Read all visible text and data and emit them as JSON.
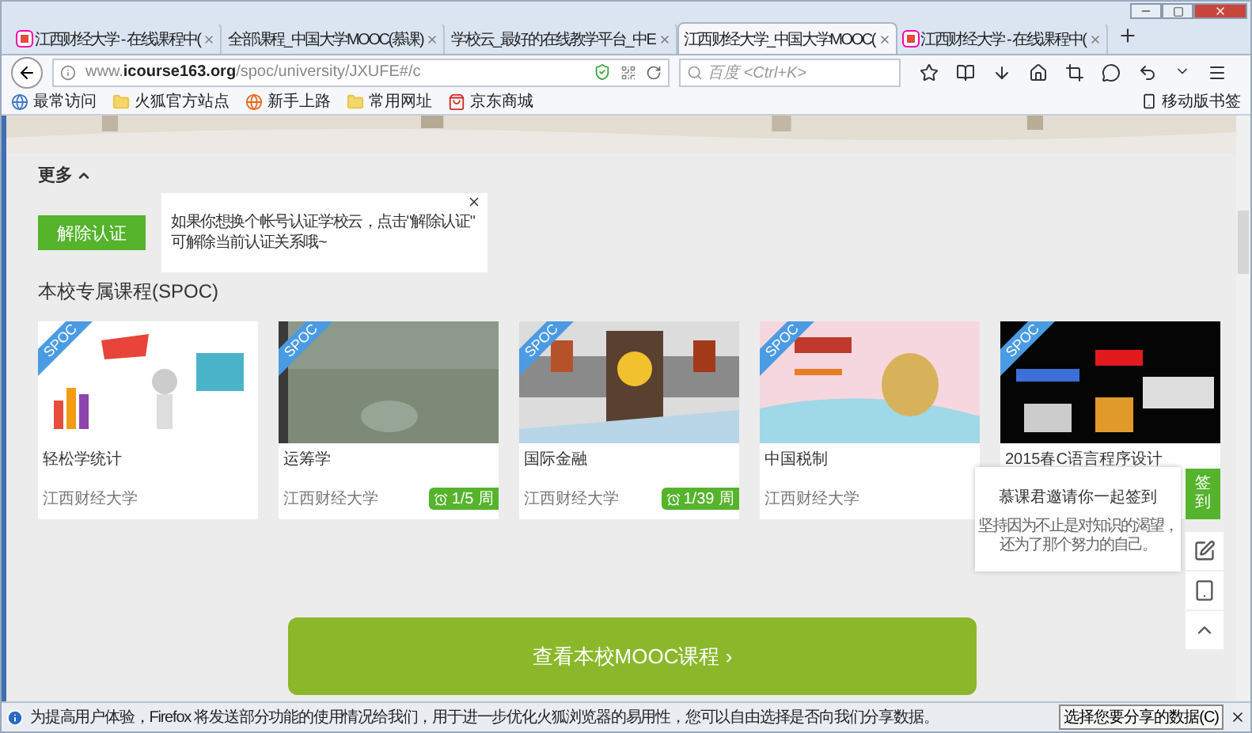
{
  "tabs": [
    {
      "title": "江西财经大学 - 在线课程中(",
      "selected": false,
      "favicon": true
    },
    {
      "title": "全部课程_中国大学MOOC(慕课)",
      "selected": false,
      "favicon": false
    },
    {
      "title": "学校云_最好的在线教学平台_中E",
      "selected": false,
      "favicon": false
    },
    {
      "title": "江西财经大学_中国大学MOOC(",
      "selected": true,
      "favicon": false
    },
    {
      "title": "江西财经大学 - 在线课程中(",
      "selected": false,
      "favicon": true
    }
  ],
  "address": {
    "url": "www.**icourse163.org**/spoc/university/JXUFE#/c"
  },
  "search": {
    "placeholder": "百度 <Ctrl+K>"
  },
  "bookmarks": [
    {
      "label": "最常访问",
      "kind": "globe"
    },
    {
      "label": "火狐官方站点",
      "kind": "folder"
    },
    {
      "label": "新手上路",
      "kind": "firefox"
    },
    {
      "label": "常用网址",
      "kind": "folder"
    },
    {
      "label": "京东商城",
      "kind": "shop"
    }
  ],
  "mobile_bookmarks": "移动版书签",
  "more_toggle": "更多",
  "unbind_button": "解除认证",
  "tip": {
    "lines": [
      "如果你想换个帐号认证学校云，点击\"解除认证\"",
      "可解除当前认证关系哦~"
    ]
  },
  "section_title": "本校专属课程(SPOC)",
  "courses": [
    {
      "title": "轻松学统计",
      "school": "江西财经大学",
      "badge": "SPOC"
    },
    {
      "title": "运筹学",
      "school": "江西财经大学",
      "badge": "SPOC",
      "week": "1/5 周"
    },
    {
      "title": "国际金融",
      "school": "江西财经大学",
      "badge": "SPOC",
      "week": "1/39 周"
    },
    {
      "title": "中国税制",
      "school": "江西财经大学",
      "badge": "SPOC"
    },
    {
      "title": "2015春C语言程序设计",
      "badge": "SPOC"
    }
  ],
  "checkin": {
    "title": "慕课君邀请你一起签到",
    "lines": [
      "坚持因为不止是对知识的渴望，",
      "还为了那个努力的自己。"
    ],
    "button": "签到"
  },
  "mooc_button": "查看本校MOOC课程 ›",
  "notification": {
    "text": "为提高用户体验，Firefox 将发送部分功能的使用情况给我们，用于进一步优化火狐浏览器的易用性，您可以自由选择是否向我们分享数据。",
    "button": "选择您要分享的数据(C)"
  }
}
